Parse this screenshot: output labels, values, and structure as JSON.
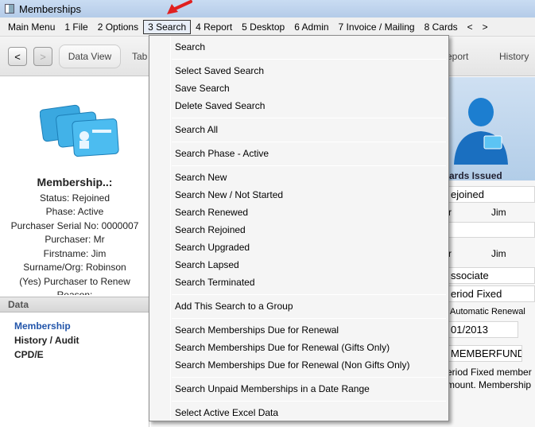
{
  "window": {
    "title": "Memberships"
  },
  "menubar": {
    "items": [
      "Main Menu",
      "1 File",
      "2 Options",
      "3 Search",
      "4 Report",
      "5 Desktop",
      "6 Admin",
      "7 Invoice / Mailing",
      "8 Cards",
      "<",
      ">"
    ],
    "active_index": 3
  },
  "toolbar": {
    "back_label": "<",
    "forward_label": ">",
    "data_view": "Data View",
    "tab2": "Tab",
    "report": "eport",
    "history": "History"
  },
  "left_panel": {
    "heading": "Membership..:",
    "lines": [
      "Status: Rejoined",
      "Phase: Active",
      "Purchaser Serial No: 0000007",
      "Purchaser: Mr",
      "Firstname: Jim",
      "Surname/Org: Robinson",
      "(Yes) Purchaser to Renew",
      "Reason:"
    ],
    "data_header": "Data",
    "data_items": [
      "Membership",
      "History / Audit",
      "CPD/E"
    ]
  },
  "right_panel": {
    "cards_issued": "ards Issued",
    "status_value": "ejoined",
    "title1": "r",
    "name1": "Jim",
    "title2": "r",
    "name2": "Jim",
    "type": "ssociate",
    "period": "eriod Fixed",
    "auto_renewal": "Automatic Renewal",
    "date": "01/2013",
    "fund": "MEMBERFUND",
    "note_line1": "eriod Fixed member",
    "note_line2": "mount. Membership"
  },
  "dropdown": {
    "items": [
      "Search",
      "Select Saved Search",
      "Save Search",
      "Delete Saved Search",
      "Search All",
      "Search Phase - Active",
      "Search New",
      "Search New / Not Started",
      "Search Renewed",
      "Search Rejoined",
      "Search Upgraded",
      "Search Lapsed",
      "Search Terminated",
      "Add This Search to a Group",
      "Search Memberships Due for Renewal",
      "Search Memberships Due for Renewal (Gifts Only)",
      "Search Memberships Due for Renewal (Non Gifts Only)",
      "Search Unpaid Memberships in a Date Range",
      "Select Active Excel Data"
    ]
  },
  "colors": {
    "accent": "#2255aa",
    "menu_bg": "#f5f5f5",
    "titlebar": "#b4cbe8",
    "marker": "#e02020"
  }
}
